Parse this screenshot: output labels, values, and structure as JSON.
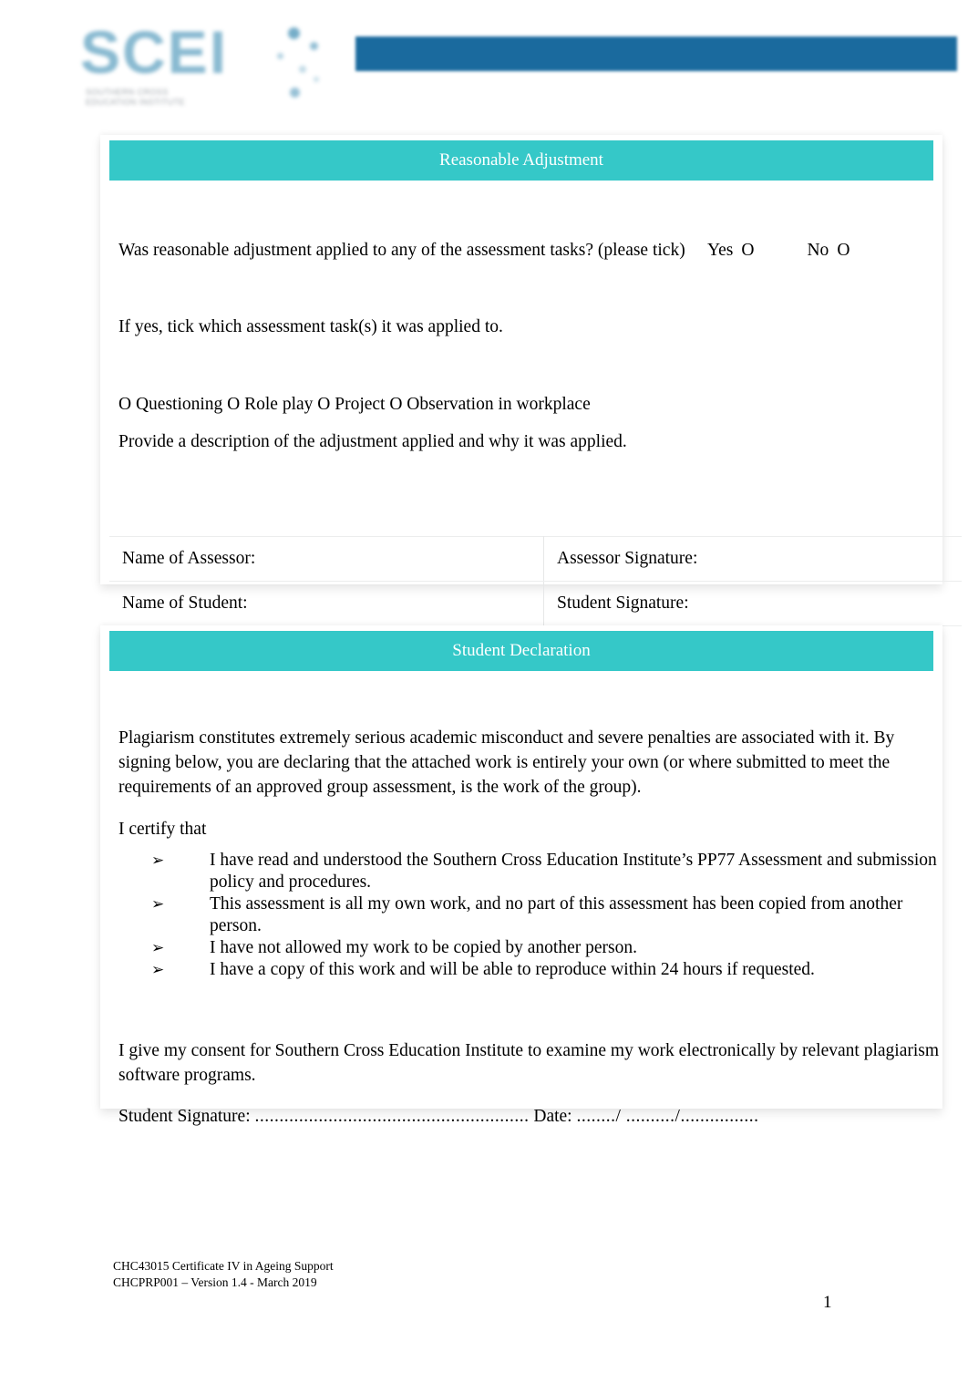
{
  "document": {
    "logo": {
      "wordmark": "SCEI",
      "subtitle_line1": "SOUTHERN CROSS",
      "subtitle_line2": "EDUCATION INSTITUTE",
      "brand_blue": "#3f87ab",
      "brand_light_blue": "#7fb4cd"
    },
    "header_bar_color": "#1a6a9e",
    "band_color": "#35c8c8"
  },
  "reasonable_adjustment": {
    "heading": "Reasonable Adjustment",
    "question": "Was reasonable adjustment applied to any of the assessment tasks? (please tick)",
    "yes_label": "Yes",
    "yes_checkbox": "O",
    "no_label": "No",
    "no_checkbox": "O",
    "if_yes_text": "If yes, tick which assessment task(s) it was applied to.",
    "task_options_line": "O Questioning O Role play O Project O Observation in workplace",
    "description_prompt": "Provide a description of the adjustment applied and why it was applied.",
    "table": {
      "rows": [
        {
          "left_label": "Name of Assessor:",
          "left_value": "",
          "right_label": "Assessor Signature:",
          "right_value": ""
        },
        {
          "left_label": "Name of Student:",
          "left_value": "",
          "right_label": "Student Signature:",
          "right_value": ""
        }
      ]
    }
  },
  "student_declaration": {
    "heading": "Student Declaration",
    "intro_paragraph": "Plagiarism constitutes extremely serious academic misconduct and severe penalties are associated with it. By signing below, you are declaring that the attached work is entirely your own (or where submitted to meet the requirements of an approved group assessment, is the work of the group).",
    "certify_label": "I certify that",
    "bullet_marker": "➢",
    "bullets": [
      "I have read and understood the Southern Cross Education Institute’s PP77 Assessment and submission policy and procedures.",
      "This assessment is all my own work, and no part of this assessment has been copied from another person.",
      "I have not allowed my work to be copied by another person.",
      "I have a copy of this work and will be able to reproduce within 24 hours if requested."
    ],
    "consent_paragraph": "I give my consent for Southern Cross Education Institute to examine my work electronically by relevant plagiarism software programs.",
    "signature_label": "Student Signature:",
    "signature_line": "........................................................",
    "date_label": "Date:",
    "date_line": "......../ ........../................"
  },
  "footer": {
    "line1": "CHC43015 Certificate IV in Ageing Support",
    "line2": "CHCPRP001 – Version 1.4 - March 2019",
    "page_number": "1"
  }
}
